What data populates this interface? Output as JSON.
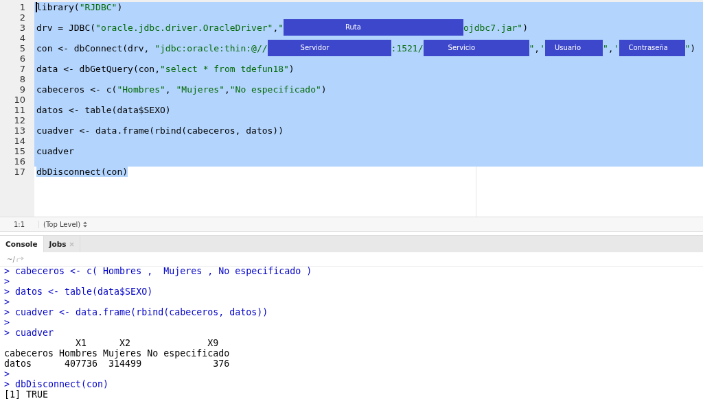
{
  "editor": {
    "lines": [
      {
        "number": "1",
        "selected": true,
        "segments": [
          {
            "kind": "code",
            "text": "library("
          },
          {
            "kind": "string",
            "text": "\"RJDBC\""
          },
          {
            "kind": "code",
            "text": ")"
          }
        ]
      },
      {
        "number": "2",
        "selected": true
      },
      {
        "number": "3",
        "selected": true,
        "segments": [
          {
            "kind": "code",
            "text": "drv = JDBC("
          },
          {
            "kind": "string",
            "text": "\"oracle.jdbc.driver.OracleDriver\""
          },
          {
            "kind": "code",
            "text": ","
          },
          {
            "kind": "string",
            "text": "\""
          },
          {
            "kind": "redaction",
            "text": "Ruta"
          },
          {
            "kind": "string",
            "text": "ojdbc7.jar\""
          },
          {
            "kind": "code",
            "text": ")"
          }
        ]
      },
      {
        "number": "4",
        "selected": true
      },
      {
        "number": "5",
        "selected": true,
        "segments": [
          {
            "kind": "code",
            "text": "con <- dbConnect(drv, "
          },
          {
            "kind": "string",
            "text": "\"jdbc:oracle:thin:@//"
          },
          {
            "kind": "redaction",
            "text": "Servidor"
          },
          {
            "kind": "string",
            "text": ":1521/"
          },
          {
            "kind": "redaction",
            "text": "Servicio"
          },
          {
            "kind": "string",
            "text": "\""
          },
          {
            "kind": "code",
            "text": ","
          },
          {
            "kind": "string",
            "text": "'"
          },
          {
            "kind": "redaction",
            "text": "Usuario"
          },
          {
            "kind": "string",
            "text": "\""
          },
          {
            "kind": "code",
            "text": ","
          },
          {
            "kind": "string",
            "text": "'"
          },
          {
            "kind": "redaction",
            "text": "Contraseña"
          },
          {
            "kind": "string",
            "text": "\""
          },
          {
            "kind": "code",
            "text": ")"
          }
        ]
      },
      {
        "number": "6",
        "selected": true
      },
      {
        "number": "7",
        "selected": true,
        "segments": [
          {
            "kind": "code",
            "text": "data <- dbGetQuery(con,"
          },
          {
            "kind": "string",
            "text": "\"select * from tdefun18\""
          },
          {
            "kind": "code",
            "text": ")"
          }
        ]
      },
      {
        "number": "8",
        "selected": true
      },
      {
        "number": "9",
        "selected": true,
        "segments": [
          {
            "kind": "code",
            "text": "cabeceros <- c("
          },
          {
            "kind": "string",
            "text": "\"Hombres\""
          },
          {
            "kind": "code",
            "text": ", "
          },
          {
            "kind": "string",
            "text": "\"Mujeres\""
          },
          {
            "kind": "code",
            "text": ","
          },
          {
            "kind": "string",
            "text": "\"No especificado\""
          },
          {
            "kind": "code",
            "text": ")"
          }
        ]
      },
      {
        "number": "10",
        "selected": true
      },
      {
        "number": "11",
        "selected": true,
        "segments": [
          {
            "kind": "code",
            "text": "datos <- table(data$SEXO)"
          }
        ]
      },
      {
        "number": "12",
        "selected": true
      },
      {
        "number": "13",
        "selected": true,
        "segments": [
          {
            "kind": "code",
            "text": "cuadver <- data.frame(rbind(cabeceros, datos))"
          }
        ]
      },
      {
        "number": "14",
        "selected": true
      },
      {
        "number": "15",
        "selected": true,
        "segments": [
          {
            "kind": "code",
            "text": "cuadver"
          }
        ]
      },
      {
        "number": "16",
        "selected": true
      },
      {
        "number": "17",
        "selected": true,
        "segments": [
          {
            "kind": "code",
            "text": "dbDisconnect(con)"
          }
        ]
      }
    ]
  },
  "status_bar": {
    "position": "1:1",
    "scope": "(Top Level)"
  },
  "tabs": [
    {
      "label": "Console",
      "selected": true,
      "closable": false
    },
    {
      "label": "Jobs",
      "selected": false,
      "closable": true
    }
  ],
  "console": {
    "path": "~/",
    "lines": [
      {
        "kind": "input",
        "prompt": ">",
        "text": "cabeceros <- c( Hombres ,  Mujeres , No especificado )"
      },
      {
        "kind": "input",
        "prompt": ">"
      },
      {
        "kind": "input",
        "prompt": ">",
        "text": "datos <- table(data$SEXO)"
      },
      {
        "kind": "input",
        "prompt": ">"
      },
      {
        "kind": "input",
        "prompt": ">",
        "text": "cuadver <- data.frame(rbind(cabeceros, datos))"
      },
      {
        "kind": "input",
        "prompt": ">"
      },
      {
        "kind": "input",
        "prompt": ">",
        "text": "cuadver"
      },
      {
        "kind": "output",
        "text": "             X1      X2              X9"
      },
      {
        "kind": "output",
        "text": "cabeceros Hombres Mujeres No especificado"
      },
      {
        "kind": "output",
        "text": "datos      407736  314499             376"
      },
      {
        "kind": "input",
        "prompt": ">"
      },
      {
        "kind": "input",
        "prompt": ">",
        "text": "dbDisconnect(con)"
      },
      {
        "kind": "output",
        "text": "[1] TRUE"
      }
    ]
  }
}
